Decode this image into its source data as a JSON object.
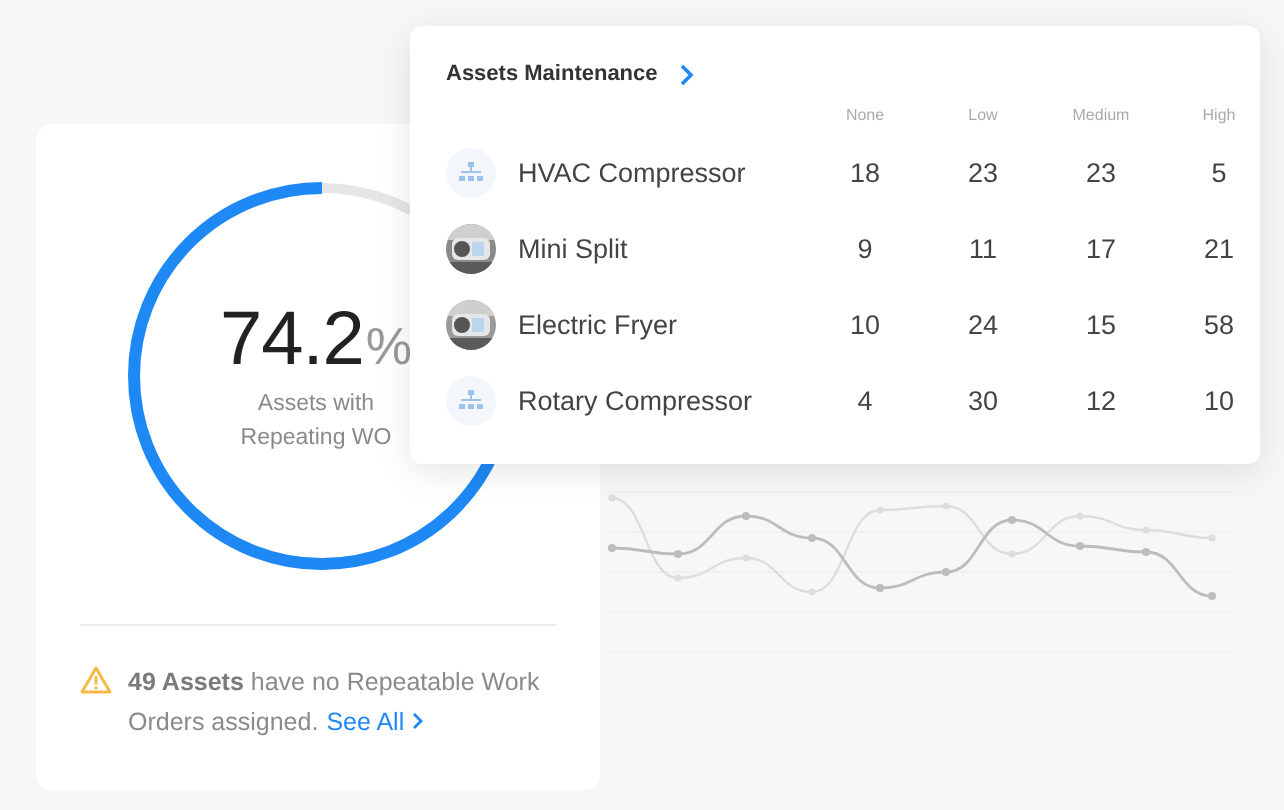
{
  "summary_card": {
    "value": "74.2",
    "unit": "%",
    "label": "Assets with Repeating WO",
    "level": 0.742,
    "notice": "**49 Assets** have no Repeatable Work Orders assigned.",
    "link": "See All"
  },
  "maintenance_card": {
    "title": "Assets Maintenance",
    "columns": [
      "None",
      "Low",
      "Medium",
      "High"
    ],
    "rows": [
      {
        "name": "HVAC Compressor",
        "kind": "icon",
        "values": [
          "18",
          "23",
          "23",
          "5"
        ]
      },
      {
        "name": "Mini Split",
        "kind": "picture",
        "values": [
          "9",
          "11",
          "17",
          "21"
        ]
      },
      {
        "name": "Electric Fryer",
        "kind": "picture",
        "values": [
          "10",
          "24",
          "15",
          "58"
        ]
      },
      {
        "name": "Rotary Compressor",
        "kind": "icon",
        "values": [
          "4",
          "30",
          "12",
          "10"
        ]
      }
    ]
  }
}
